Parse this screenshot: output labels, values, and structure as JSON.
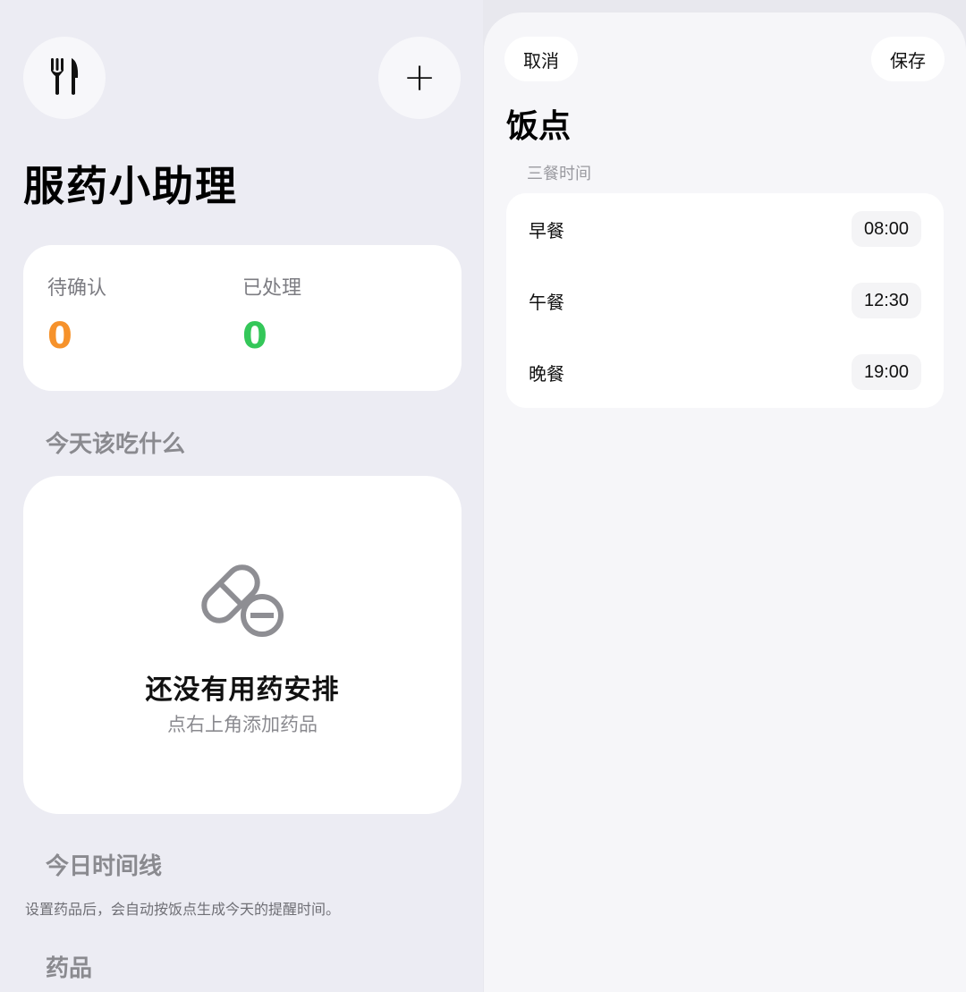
{
  "left": {
    "header": {
      "meal_button_icon": "fork-knife-icon",
      "add_button_label": "+"
    },
    "title": "服药小助理",
    "stats": {
      "pending_label": "待确认",
      "pending_value": "0",
      "done_label": "已处理",
      "done_value": "0",
      "colors": {
        "pending": "#f6922b",
        "done": "#34c759"
      }
    },
    "today_section": {
      "heading": "今天该吃什么",
      "empty_icon": "pill-icon",
      "empty_title": "还没有用药安排",
      "empty_subtitle": "点右上角添加药品"
    },
    "timeline_section": {
      "heading": "今日时间线",
      "hint": "设置药品后，会自动按饭点生成今天的提醒时间。"
    },
    "meds_section": {
      "heading": "药品"
    }
  },
  "sheet": {
    "cancel_label": "取消",
    "save_label": "保存",
    "title": "饭点",
    "group_label": "三餐时间",
    "meals": [
      {
        "name": "早餐",
        "time": "08:00"
      },
      {
        "name": "午餐",
        "time": "12:30"
      },
      {
        "name": "晚餐",
        "time": "19:00"
      }
    ]
  }
}
